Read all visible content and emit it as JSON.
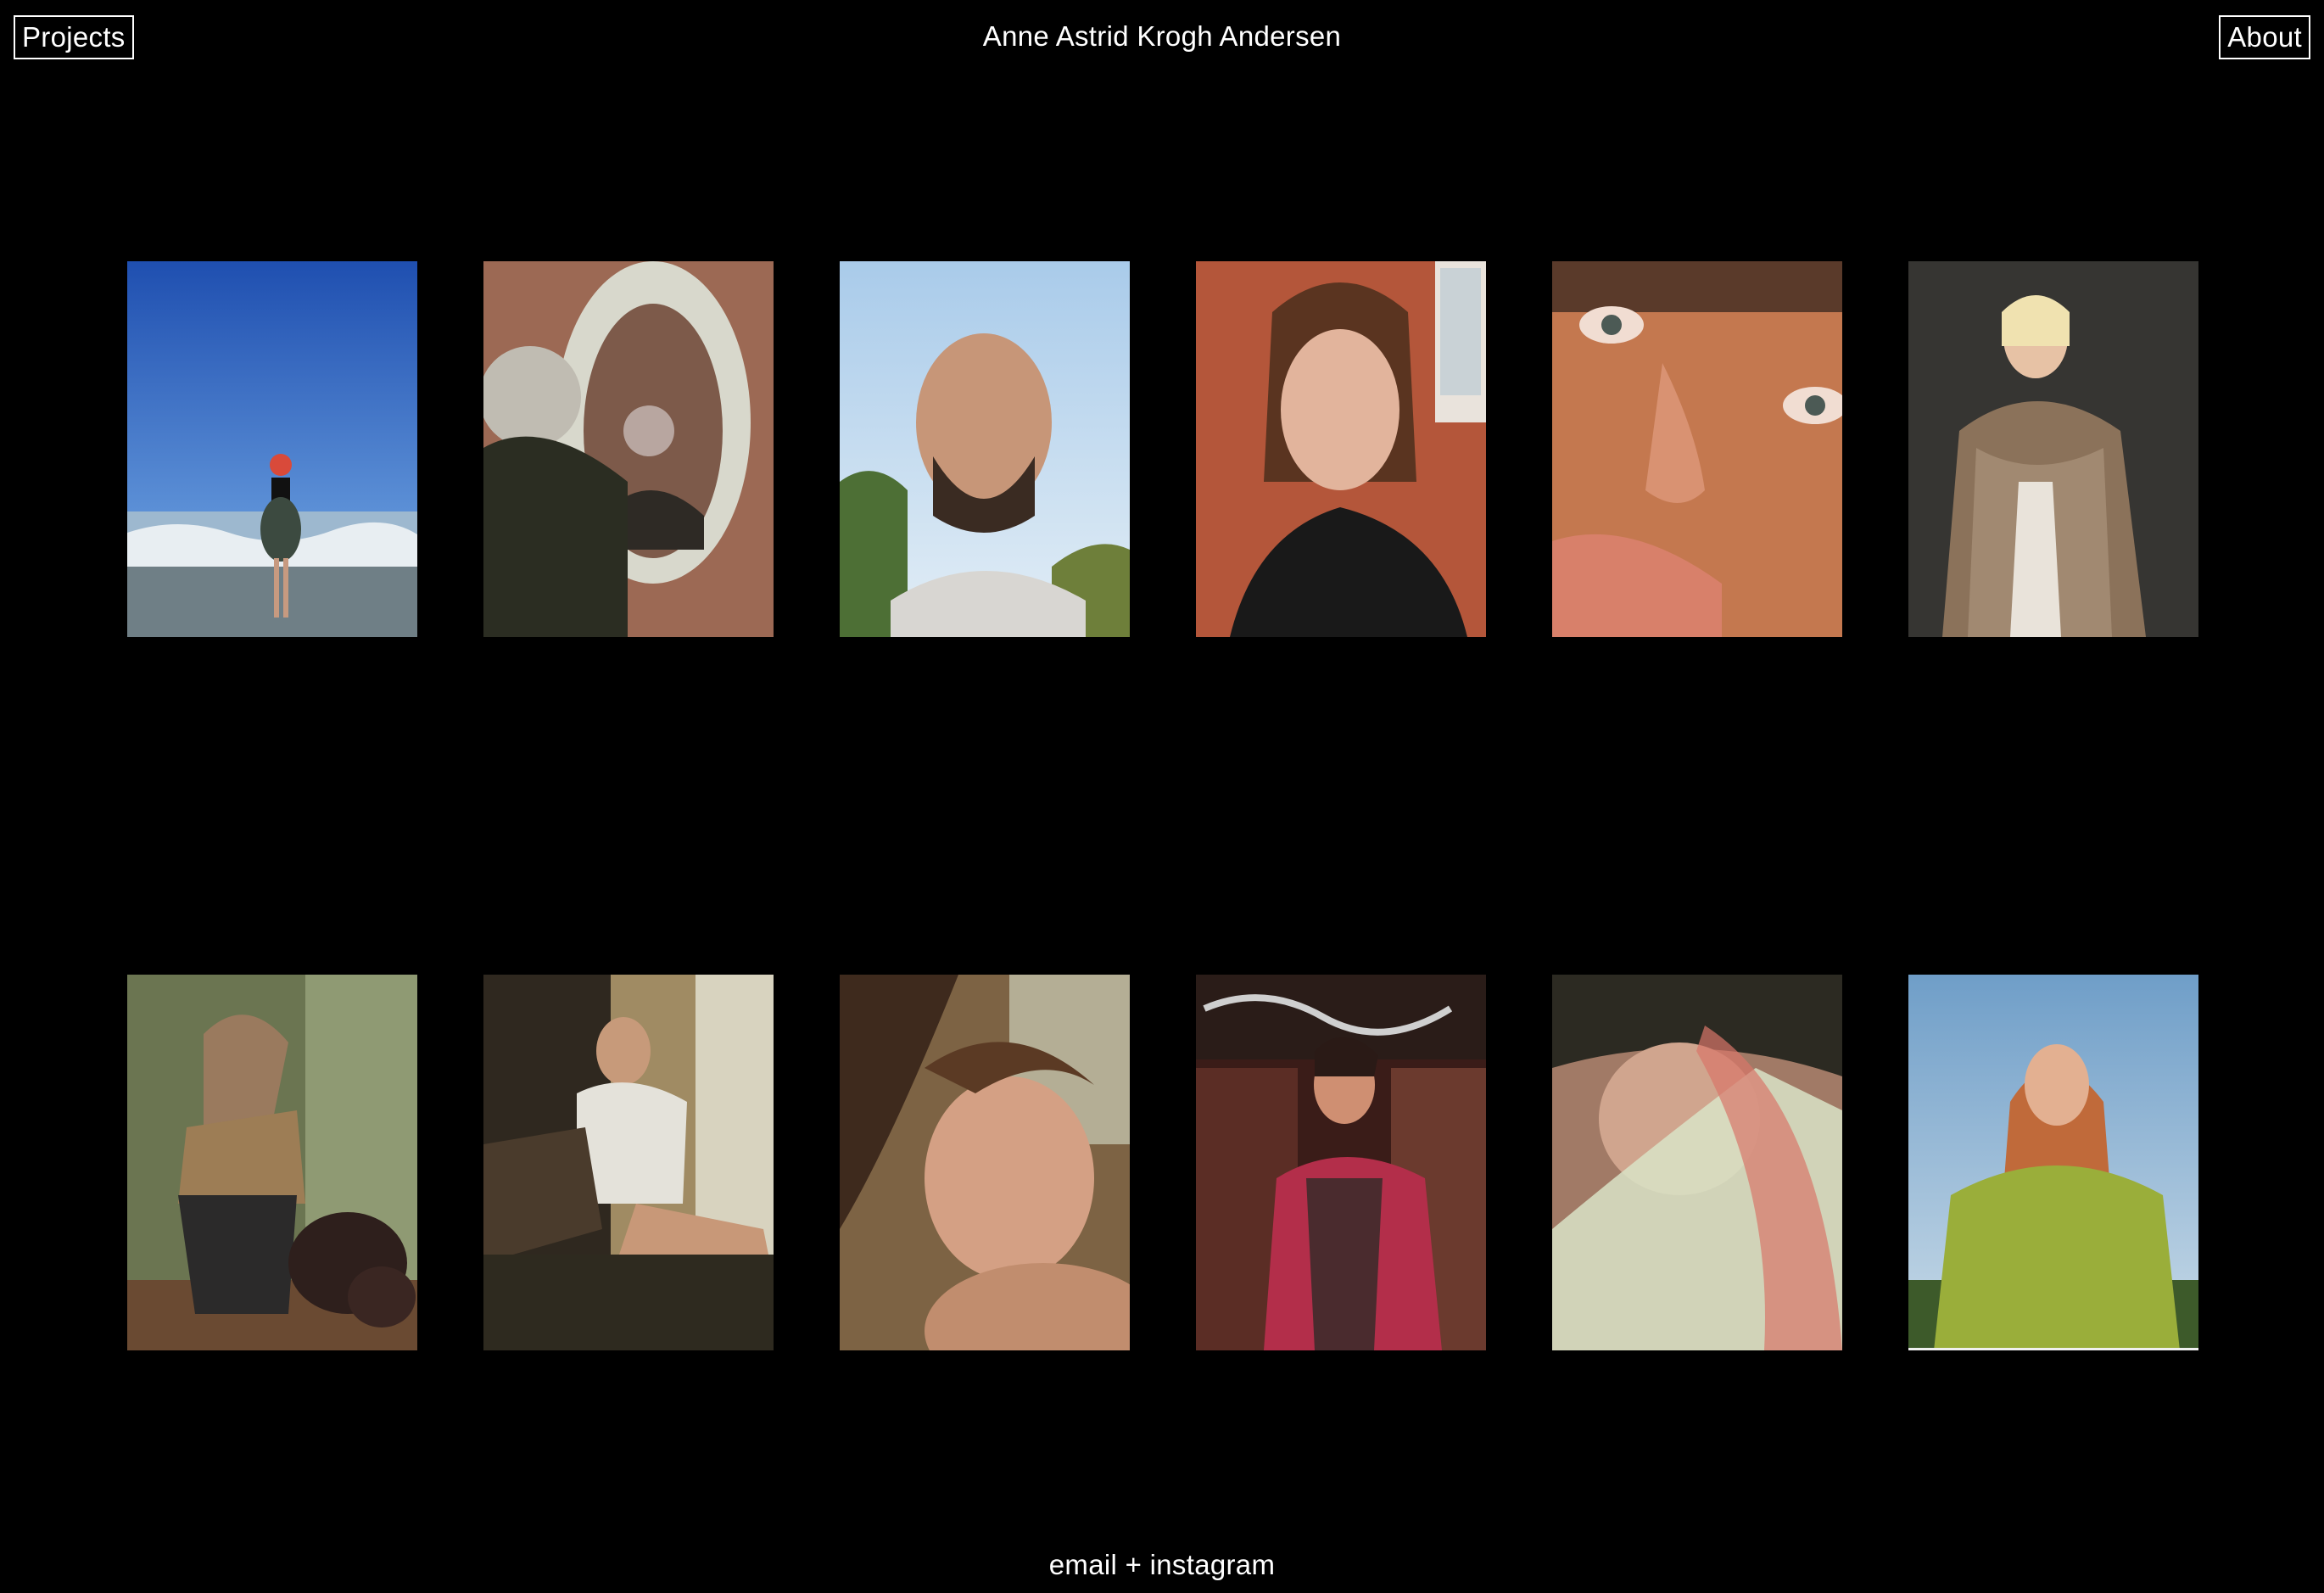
{
  "header": {
    "projects_label": "Projects",
    "title": "Anne Astrid Krogh Andersen",
    "about_label": "About"
  },
  "footer": {
    "email_label": "email",
    "separator": "+",
    "instagram_label": "instagram"
  },
  "gallery": [
    {
      "id": "photo-beach-red-hat",
      "bg": "#2a64b8"
    },
    {
      "id": "photo-mirror-woman",
      "bg": "#9b6a52"
    },
    {
      "id": "photo-bald-man-sky",
      "bg": "#9fc3e6"
    },
    {
      "id": "photo-woman-red-wall",
      "bg": "#b2553a"
    },
    {
      "id": "photo-closeup-face",
      "bg": "#c47a52"
    },
    {
      "id": "photo-fur-coat",
      "bg": "#3b3a38"
    },
    {
      "id": "photo-woman-dog",
      "bg": "#6d7550"
    },
    {
      "id": "photo-man-sitting-room",
      "bg": "#3a3126"
    },
    {
      "id": "photo-woman-lying",
      "bg": "#8b6a45"
    },
    {
      "id": "photo-man-graffiti",
      "bg": "#4a2420"
    },
    {
      "id": "photo-man-fabric",
      "bg": "#a07a66"
    },
    {
      "id": "photo-green-sweater",
      "bg": "#8fb3d2"
    }
  ]
}
